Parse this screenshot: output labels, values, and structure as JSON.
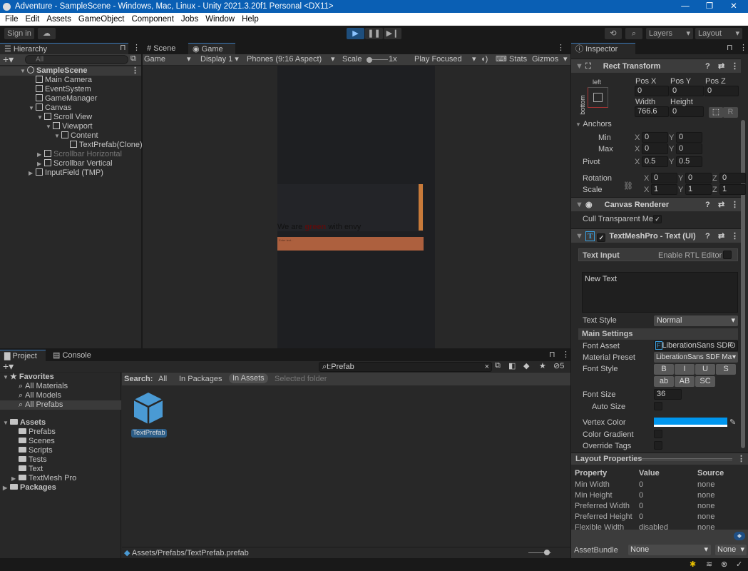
{
  "window": {
    "title": "Adventure - SampleScene - Windows, Mac, Linux - Unity 2021.3.20f1 Personal <DX11>",
    "minimize": "—",
    "maximize": "❐",
    "close": "✕"
  },
  "menu": [
    "File",
    "Edit",
    "Assets",
    "GameObject",
    "Component",
    "Jobs",
    "Window",
    "Help"
  ],
  "toolbar": {
    "sign_in": "Sign in",
    "layers": "Layers",
    "layout": "Layout"
  },
  "hierarchy": {
    "tab": "Hierarchy",
    "search_placeholder": "All",
    "items": [
      {
        "label": "SampleScene",
        "depth": 0,
        "arrow": "▼",
        "bold": true
      },
      {
        "label": "Main Camera",
        "depth": 1,
        "arrow": ""
      },
      {
        "label": "EventSystem",
        "depth": 1,
        "arrow": ""
      },
      {
        "label": "GameManager",
        "depth": 1,
        "arrow": ""
      },
      {
        "label": "Canvas",
        "depth": 1,
        "arrow": "▼"
      },
      {
        "label": "Scroll View",
        "depth": 2,
        "arrow": "▼"
      },
      {
        "label": "Viewport",
        "depth": 3,
        "arrow": "▼"
      },
      {
        "label": "Content",
        "depth": 4,
        "arrow": "▼"
      },
      {
        "label": "TextPrefab(Clone)",
        "depth": 5,
        "arrow": ""
      },
      {
        "label": "Scrollbar Horizontal",
        "depth": 2,
        "arrow": "▶",
        "dim": true
      },
      {
        "label": "Scrollbar Vertical",
        "depth": 2,
        "arrow": "▶"
      },
      {
        "label": "InputField (TMP)",
        "depth": 1,
        "arrow": "▶"
      }
    ]
  },
  "game": {
    "tabs": [
      "Scene",
      "Game"
    ],
    "display_mode": "Game",
    "display": "Display 1",
    "aspect": "Phones (9:16 Aspect)",
    "scale_label": "Scale",
    "scale_value": "1x",
    "play_mode": "Play Focused",
    "stats": "Stats",
    "gizmos": "Gizmos",
    "text_before": "We are ",
    "text_green": "green",
    "text_after": " with envy",
    "input_placeholder": "Enter text..."
  },
  "inspector": {
    "tab": "Inspector",
    "rect": {
      "title": "Rect Transform",
      "anchor_h": "left",
      "anchor_v": "bottom",
      "pos_x_label": "Pos X",
      "pos_y_label": "Pos Y",
      "pos_z_label": "Pos Z",
      "pos_x": "0",
      "pos_y": "0",
      "pos_z": "0",
      "width_label": "Width",
      "height_label": "Height",
      "width": "766.6",
      "height": "0",
      "r_button": "R",
      "anchors": "Anchors",
      "min": "Min",
      "max": "Max",
      "pivot": "Pivot",
      "min_x": "0",
      "min_y": "0",
      "max_x": "0",
      "max_y": "0",
      "pivot_x": "0.5",
      "pivot_y": "0.5",
      "rotation": "Rotation",
      "scale": "Scale",
      "rot_x": "0",
      "rot_y": "0",
      "rot_z": "0",
      "scale_x": "1",
      "scale_y": "1",
      "scale_z": "1",
      "X": "X",
      "Y": "Y",
      "Z": "Z"
    },
    "canvas_renderer": {
      "title": "Canvas Renderer",
      "cull": "Cull Transparent Mes"
    },
    "tmp": {
      "title": "TextMeshPro - Text (UI)",
      "text_input": "Text Input",
      "rtl": "Enable RTL Editor",
      "text": "New Text",
      "text_style_label": "Text Style",
      "text_style": "Normal",
      "main_settings": "Main Settings",
      "font_asset_label": "Font Asset",
      "font_asset": "LiberationSans SDF",
      "material_label": "Material Preset",
      "material": "LiberationSans SDF Mat",
      "font_style_label": "Font Style",
      "styles": [
        "B",
        "I",
        "U",
        "S"
      ],
      "styles2": [
        "ab",
        "AB",
        "SC"
      ],
      "font_size_label": "Font Size",
      "font_size": "36",
      "auto_size": "Auto Size",
      "vertex_color_label": "Vertex Color",
      "vertex_color": "#0096ee",
      "gradient": "Color Gradient",
      "override": "Override Tags"
    },
    "layout": {
      "title": "Layout Properties",
      "headers": [
        "Property",
        "Value",
        "Source"
      ],
      "rows": [
        [
          "Min Width",
          "0",
          "none"
        ],
        [
          "Min Height",
          "0",
          "none"
        ],
        [
          "Preferred Width",
          "0",
          "none"
        ],
        [
          "Preferred Height",
          "0",
          "none"
        ],
        [
          "Flexible Width",
          "disabled",
          "none"
        ]
      ]
    },
    "assetbundle": {
      "label": "AssetBundle",
      "name": "None",
      "variant": "None"
    }
  },
  "project": {
    "tabs": [
      "Project",
      "Console"
    ],
    "search": "t:Prefab",
    "hidden_count": "5",
    "search_label": "Search:",
    "scopes": [
      "All",
      "In Packages",
      "In Assets",
      "Selected folder"
    ],
    "favorites": "Favorites",
    "fav_items": [
      "All Materials",
      "All Models",
      "All Prefabs"
    ],
    "assets": "Assets",
    "folders": [
      "Prefabs",
      "Scenes",
      "Scripts",
      "Tests",
      "Text",
      "TextMesh Pro"
    ],
    "packages": "Packages",
    "asset_name": "TextPrefab",
    "path": "Assets/Prefabs/TextPrefab.prefab"
  }
}
